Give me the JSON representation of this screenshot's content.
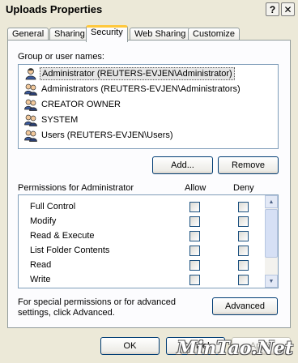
{
  "window": {
    "title": "Uploads Properties"
  },
  "titlebar_buttons": {
    "help": "?",
    "close": "✕"
  },
  "tabs": [
    {
      "label": "General"
    },
    {
      "label": "Sharing"
    },
    {
      "label": "Security",
      "active": true
    },
    {
      "label": "Web Sharing"
    },
    {
      "label": "Customize"
    }
  ],
  "security": {
    "group_label": "Group or user names:",
    "users": [
      {
        "name": "Administrator (REUTERS-EVJEN\\Administrator)",
        "icon": "user-icon",
        "selected": true
      },
      {
        "name": "Administrators (REUTERS-EVJEN\\Administrators)",
        "icon": "group-icon"
      },
      {
        "name": "CREATOR OWNER",
        "icon": "group-icon"
      },
      {
        "name": "SYSTEM",
        "icon": "group-icon"
      },
      {
        "name": "Users (REUTERS-EVJEN\\Users)",
        "icon": "group-icon"
      }
    ],
    "add_button": "Add...",
    "remove_button": "Remove",
    "permissions_label": "Permissions for Administrator",
    "allow_header": "Allow",
    "deny_header": "Deny",
    "permissions": [
      {
        "name": "Full Control",
        "allow": false,
        "deny": false
      },
      {
        "name": "Modify",
        "allow": false,
        "deny": false
      },
      {
        "name": "Read & Execute",
        "allow": false,
        "deny": false
      },
      {
        "name": "List Folder Contents",
        "allow": false,
        "deny": false
      },
      {
        "name": "Read",
        "allow": false,
        "deny": false
      },
      {
        "name": "Write",
        "allow": false,
        "deny": false
      }
    ],
    "advanced_text": "For special permissions or for advanced settings, click Advanced.",
    "advanced_button": "Advanced"
  },
  "footer": {
    "ok": "OK",
    "cancel": "Cancel",
    "apply": "Apply"
  },
  "watermark": "MinTao.Net"
}
